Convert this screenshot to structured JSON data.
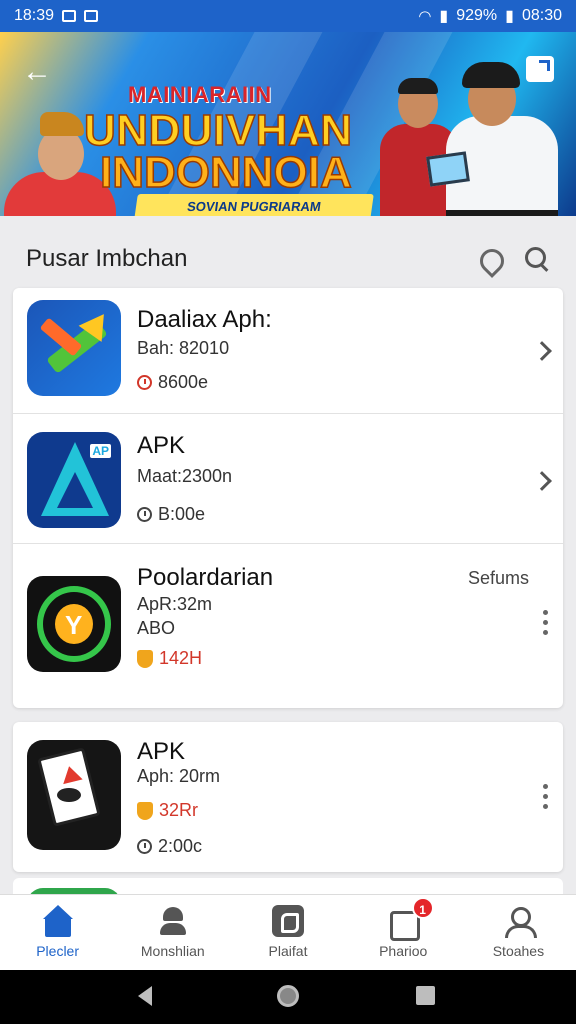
{
  "status_bar": {
    "time_left": "18:39",
    "battery": "929%",
    "time_right": "08:30"
  },
  "banner": {
    "small_title": "MAINIARAIIN",
    "line1": "UNDUIVHAN",
    "line2": "INDONNOIA",
    "ribbon": "SOVIAN PUGRIARAM IINGDONIGARAN"
  },
  "section": {
    "title": "Pusar Imbchan"
  },
  "apps": [
    {
      "name": "Daaliax Aph:",
      "sub": "Bah: 82010",
      "meta": "8600e"
    },
    {
      "name": "APK",
      "sub": "Maat:2300n",
      "meta": "B:00e"
    },
    {
      "name": "Poolardarian",
      "side": "Sefums",
      "sub": "ApR:32m",
      "sub2": "ABO",
      "meta": "142H"
    },
    {
      "name": "APK",
      "sub": "Aph: 20rm",
      "meta": "32Rr",
      "meta2": "2:00c"
    }
  ],
  "bottom_nav": [
    {
      "label": "Plecler",
      "icon": "home-icon"
    },
    {
      "label": "Monshlian",
      "icon": "person-icon"
    },
    {
      "label": "Plaifat",
      "icon": "phone-icon"
    },
    {
      "label": "Pharioo",
      "icon": "document-icon",
      "badge": "1"
    },
    {
      "label": "Stoahes",
      "icon": "user-icon"
    }
  ],
  "colors": {
    "primary": "#1e63c9",
    "badge": "#e4262a",
    "accent_red": "#d2372a",
    "accent_orange": "#f0a51c"
  }
}
